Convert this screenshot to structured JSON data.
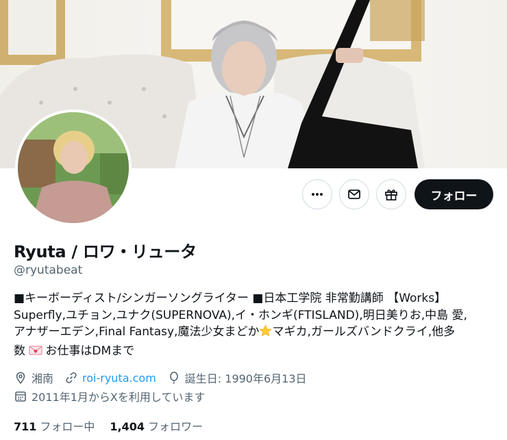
{
  "profile": {
    "display_name": "Ryuta / ロワ・リュータ",
    "handle": "@ryutabeat",
    "bio_line1": "■キーボーディスト/シンガーソングライター ■日本工学院 非常勤講師 【Works】",
    "bio_line2": "Superfly,ユチョン,ユナク(SUPERNOVA),イ・ホンギ(FTISLAND),明日美りお,中島 愛,",
    "bio_line3a": "アナザーエデン,Final Fantasy,魔法少女まどか",
    "bio_line3b": "マギカ,ガールズバンドクライ,他多",
    "bio_line4a": "数 ",
    "bio_line4b": "お仕事はDMまで",
    "location": "湘南",
    "website": "roi-ryuta.com",
    "birthday": "誕生日: 1990年6月13日",
    "joined": "2011年1月からXを利用しています",
    "following_count": "711",
    "following_label": "フォロー中",
    "followers_count": "1,404",
    "followers_label": "フォロワー"
  },
  "actions": {
    "follow_label": "フォロー",
    "more_icon": "more-icon",
    "message_icon": "mail-icon",
    "gift_icon": "gift-icon"
  },
  "icons": {
    "location": "location-pin-icon",
    "website": "link-icon",
    "birthday": "balloon-icon",
    "joined": "calendar-icon",
    "bio_star": "star-emoji-icon",
    "bio_letter": "love-letter-emoji-icon"
  },
  "colors": {
    "text": "#0f1419",
    "secondary": "#536471",
    "link": "#1d9bf0",
    "follow_button": "#0f1419"
  }
}
